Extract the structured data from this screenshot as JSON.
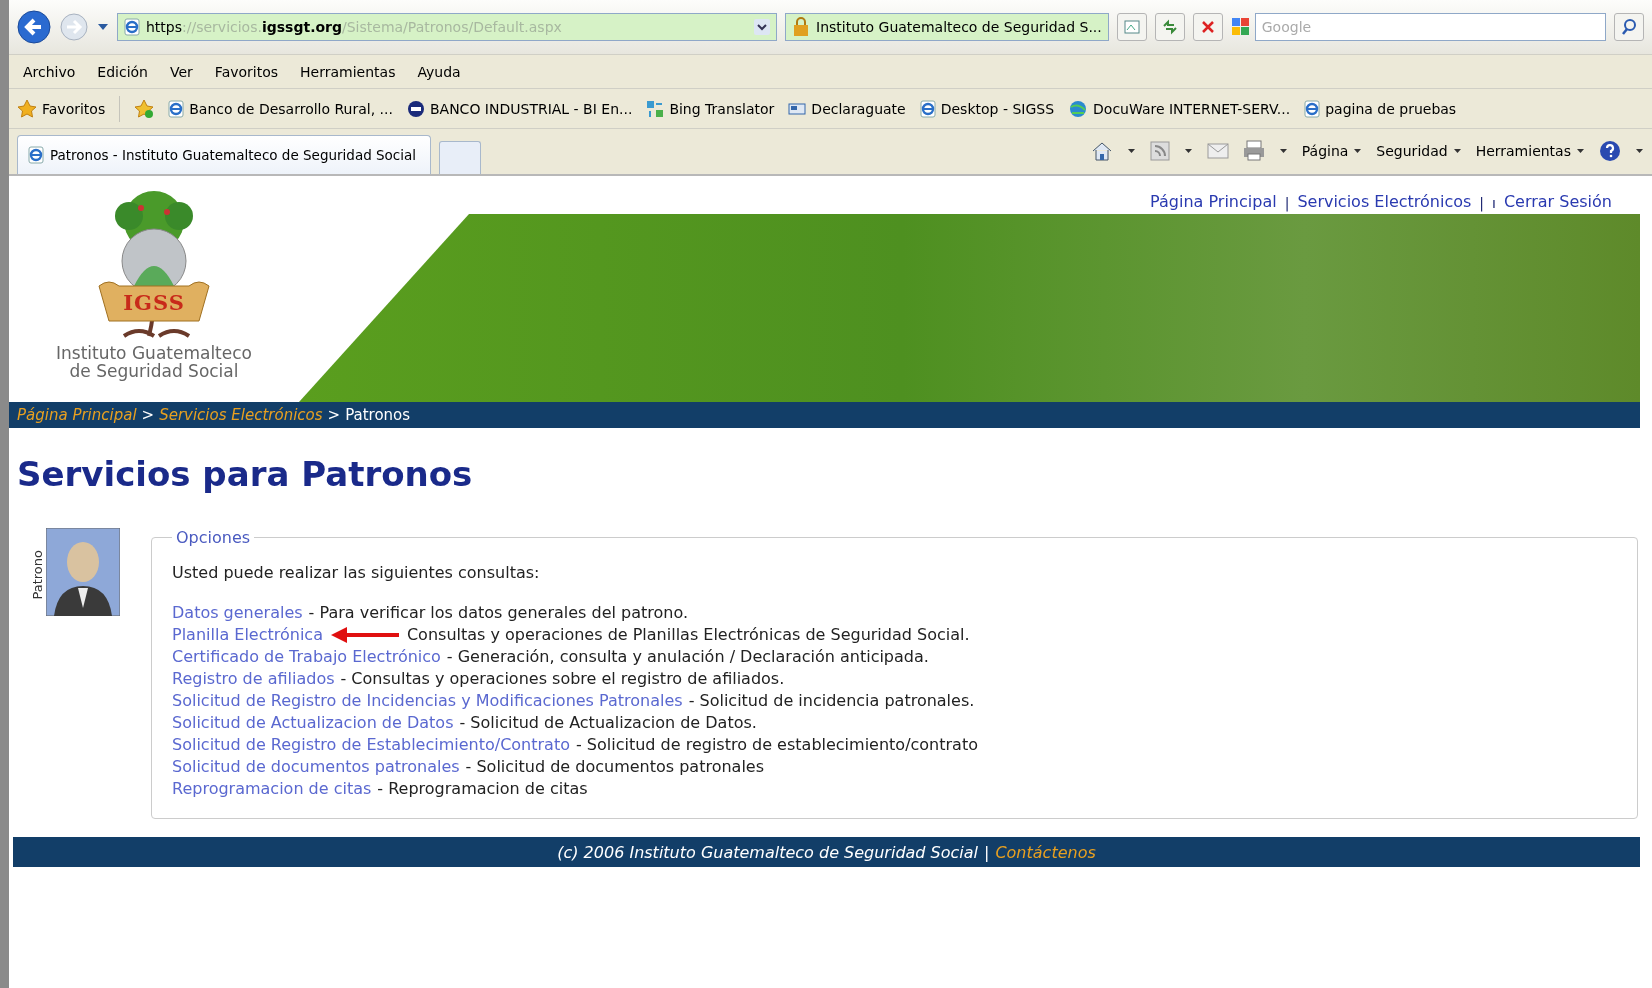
{
  "browser": {
    "address": {
      "scheme": "https",
      "host_prefix": "://servicios.",
      "domain": "igssgt.org",
      "path": "/Sistema/Patronos/Default.aspx"
    },
    "site_identity": "Instituto Guatemalteco de Seguridad S...",
    "search": {
      "placeholder": "Google"
    },
    "menu": [
      "Archivo",
      "Edición",
      "Ver",
      "Favoritos",
      "Herramientas",
      "Ayuda"
    ],
    "favorites_label": "Favoritos",
    "favorites": [
      {
        "label": "Banco de Desarrollo Rural, ...",
        "kind": "page"
      },
      {
        "label": "BANCO INDUSTRIAL - BI En...",
        "kind": "bank"
      },
      {
        "label": "Bing Translator",
        "kind": "translator"
      },
      {
        "label": "Declaraguate",
        "kind": "declare"
      },
      {
        "label": "Desktop - SIGSS",
        "kind": "page"
      },
      {
        "label": "DocuWare INTERNET-SERV...",
        "kind": "globe"
      },
      {
        "label": "pagina de pruebas",
        "kind": "page"
      }
    ],
    "tabs": [
      {
        "label": "Patronos - Instituto Guatemalteco de Seguridad Social",
        "selected": true
      }
    ],
    "commands": [
      "Página",
      "Seguridad",
      "Herramientas"
    ]
  },
  "header": {
    "logo_mark": "IGSS",
    "logo_name": [
      "Instituto Guatemalteco",
      "de Seguridad Social"
    ],
    "links": [
      {
        "kind": "link",
        "label": "Página Principal"
      },
      {
        "kind": "separator",
        "label": "|"
      },
      {
        "kind": "link",
        "label": "Servicios Electrónicos"
      },
      {
        "kind": "separator",
        "label": "|"
      },
      {
        "kind": "separator",
        "label": "ı"
      },
      {
        "kind": "link",
        "label": "Cerrar Sesión"
      }
    ]
  },
  "breadcrumb": [
    {
      "kind": "link",
      "label": "Página Principal"
    },
    {
      "kind": "separator",
      "label": ">"
    },
    {
      "kind": "link",
      "label": "Servicios Electrónicos"
    },
    {
      "kind": "separator",
      "label": ">"
    },
    {
      "kind": "current",
      "label": "Patronos"
    }
  ],
  "heading": "Servicios para Patronos",
  "profile": {
    "label": "Patrono"
  },
  "options": {
    "legend": "Opciones",
    "intro": "Usted puede realizar las siguientes consultas:",
    "items": [
      {
        "link": "Datos generales",
        "description": "- Para verificar los datos generales del patrono.",
        "marked": false
      },
      {
        "link": "Planilla Electrónica",
        "description": "Consultas y operaciones de Planillas Electrónicas de Seguridad Social.",
        "marked": true
      },
      {
        "link": "Certificado de Trabajo Electrónico",
        "description": "- Generación, consulta y anulación / Declaración anticipada.",
        "marked": false
      },
      {
        "link": "Registro de afiliados",
        "description": "- Consultas y operaciones sobre el registro de afiliados.",
        "marked": false
      },
      {
        "link": "Solicitud de Registro de Incidencias y Modificaciones Patronales",
        "description": "- Solicitud de incidencia patronales.",
        "marked": false
      },
      {
        "link": "Solicitud de Actualizacion de Datos",
        "description": "- Solicitud de Actualizacion de Datos.",
        "marked": false
      },
      {
        "link": "Solicitud de Registro de Establecimiento/Contrato",
        "description": "- Solicitud de registro de establecimiento/contrato",
        "marked": false
      },
      {
        "link": "Solicitud de documentos patronales",
        "description": "- Solicitud de documentos patronales",
        "marked": false
      },
      {
        "link": "Reprogramacion de citas",
        "description": "- Reprogramacion de citas",
        "marked": false
      }
    ]
  },
  "footer": {
    "text": "(c) 2006 Instituto Guatemalteco de Seguridad Social",
    "separator": "|",
    "link": "Contáctenos"
  }
}
